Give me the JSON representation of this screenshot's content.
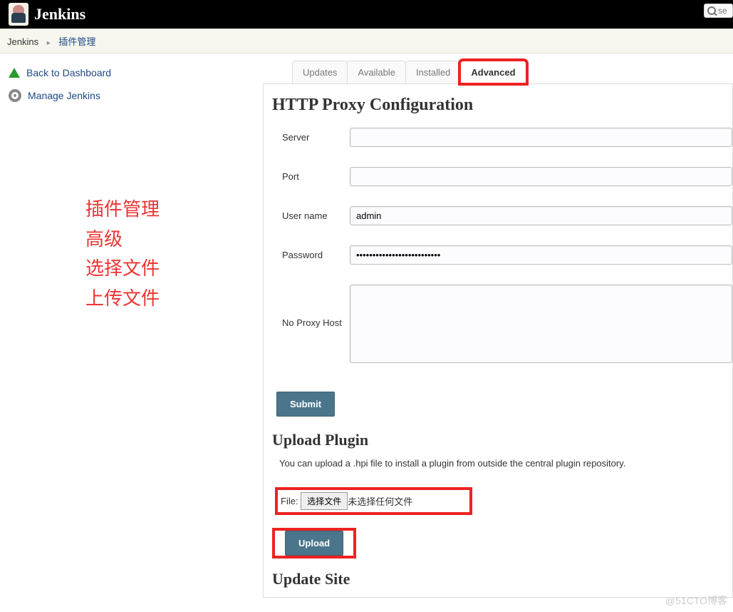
{
  "header": {
    "title": "Jenkins",
    "search_placeholder": "se"
  },
  "breadcrumb": {
    "root": "Jenkins",
    "current": "插件管理"
  },
  "sidebar": {
    "items": [
      {
        "label": "Back to Dashboard"
      },
      {
        "label": "Manage Jenkins"
      }
    ]
  },
  "annotation": {
    "lines": [
      "插件管理",
      "高级",
      "选择文件",
      "上传文件"
    ]
  },
  "tabs": {
    "items": [
      "Updates",
      "Available",
      "Installed",
      "Advanced"
    ],
    "active": "Advanced"
  },
  "proxy": {
    "heading": "HTTP Proxy Configuration",
    "server_label": "Server",
    "server_value": "",
    "port_label": "Port",
    "port_value": "",
    "user_label": "User name",
    "user_value": "admin",
    "password_label": "Password",
    "password_value": "••••••••••••••••••••••••••",
    "noproxy_label": "No Proxy Host",
    "noproxy_value": "",
    "submit_label": "Submit"
  },
  "upload": {
    "heading": "Upload Plugin",
    "description": "You can upload a .hpi file to install a plugin from outside the central plugin repository.",
    "file_label": "File:",
    "choose_label": "选择文件",
    "no_file_text": "未选择任何文件",
    "upload_label": "Upload"
  },
  "update_site": {
    "heading": "Update Site"
  },
  "watermark": "@51CTO博客"
}
